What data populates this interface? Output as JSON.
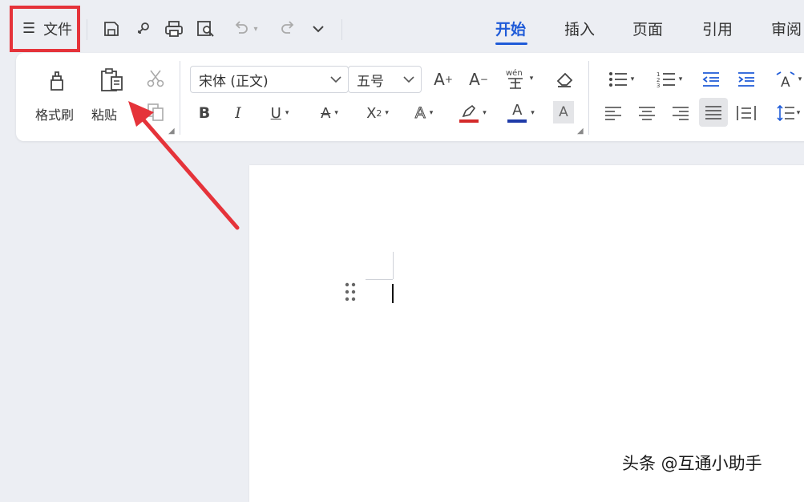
{
  "file_menu": {
    "icon": "hamburger-icon",
    "label": "文件"
  },
  "quick_access": [
    "save-icon",
    "link-icon",
    "print-icon",
    "print-preview-icon",
    "undo-icon",
    "redo-icon",
    "more-chevron-icon"
  ],
  "tabs": [
    {
      "label": "开始",
      "active": true
    },
    {
      "label": "插入",
      "active": false
    },
    {
      "label": "页面",
      "active": false
    },
    {
      "label": "引用",
      "active": false
    },
    {
      "label": "审阅",
      "active": false
    }
  ],
  "clipboard": {
    "format_painter_label": "格式刷",
    "paste_label": "粘贴"
  },
  "font": {
    "name": "宋体 (正文)",
    "size": "五号"
  },
  "colors": {
    "accent": "#1f5bd8",
    "highlight_box": "#e5333a",
    "arrow": "#e5333a",
    "font_color": "#1e3aa8",
    "highlight_color": "#d42a2a"
  },
  "watermark": "头条 @互通小助手"
}
